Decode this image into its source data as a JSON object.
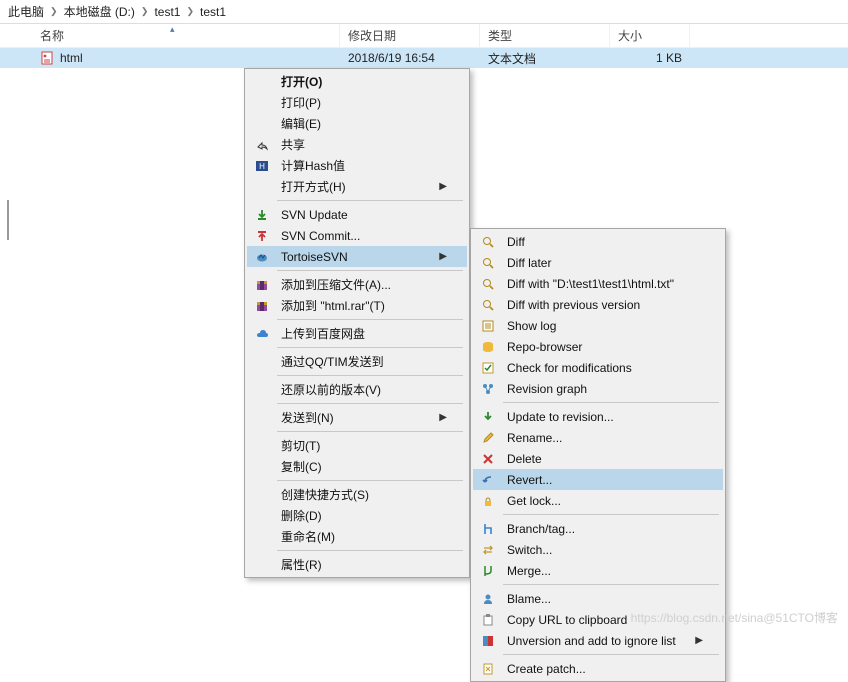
{
  "breadcrumb": {
    "pc": "此电脑",
    "d": "本地磁盘 (D:)",
    "t1": "test1",
    "t2": "test1"
  },
  "headers": {
    "name": "名称",
    "date": "修改日期",
    "type": "类型",
    "size": "大小"
  },
  "file": {
    "name": "html",
    "date": "2018/6/19 16:54",
    "type": "文本文档",
    "size": "1 KB"
  },
  "menu1": {
    "open": "打开(O)",
    "print": "打印(P)",
    "edit": "编辑(E)",
    "share": "共享",
    "hash": "计算Hash值",
    "openwith": "打开方式(H)",
    "svnupdate": "SVN Update",
    "svncommit": "SVN Commit...",
    "tortoise": "TortoiseSVN",
    "addarchive": "添加到压缩文件(A)...",
    "addrar": "添加到 \"html.rar\"(T)",
    "baidu": "上传到百度网盘",
    "qq": "通过QQ/TIM发送到",
    "restore": "还原以前的版本(V)",
    "sendto": "发送到(N)",
    "cut": "剪切(T)",
    "copy": "复制(C)",
    "shortcut": "创建快捷方式(S)",
    "delete": "删除(D)",
    "rename": "重命名(M)",
    "properties": "属性(R)"
  },
  "menu2": {
    "diff": "Diff",
    "difflater": "Diff later",
    "diffwith": "Diff with \"D:\\test1\\test1\\html.txt\"",
    "diffprev": "Diff with previous version",
    "showlog": "Show log",
    "repobrowser": "Repo-browser",
    "checkmods": "Check for modifications",
    "revgraph": "Revision graph",
    "update": "Update to revision...",
    "rename": "Rename...",
    "delete": "Delete",
    "revert": "Revert...",
    "getlock": "Get lock...",
    "branchtag": "Branch/tag...",
    "switch": "Switch...",
    "merge": "Merge...",
    "blame": "Blame...",
    "copyurl": "Copy URL to clipboard",
    "unversion": "Unversion and add to ignore list",
    "createpatch": "Create patch..."
  },
  "watermark": "https://blog.csdn.net/sina@51CTO博客"
}
